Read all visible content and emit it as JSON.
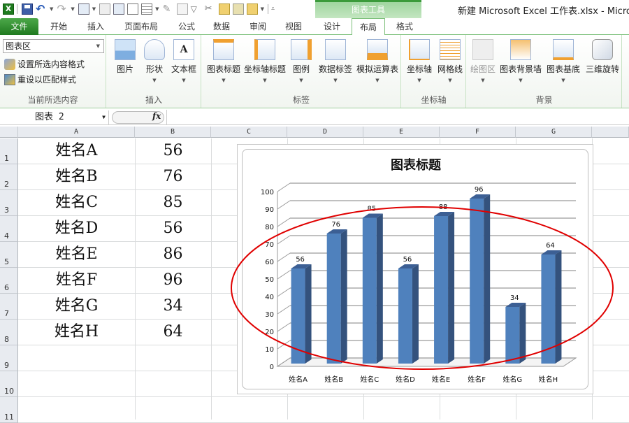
{
  "window": {
    "title": "新建 Microsoft Excel 工作表.xlsx  -  Microsoft Excel",
    "context_group": "图表工具"
  },
  "quick_access": {
    "icons": [
      "excel-logo-icon",
      "save-icon",
      "undo-icon",
      "redo-icon",
      "form-icon",
      "form2-icon",
      "form3-icon",
      "print-preview-icon",
      "table-icon",
      "format-painter-icon",
      "copy-icon",
      "filter-icon",
      "clear-icon",
      "macro-icon",
      "properties-icon",
      "tools-icon",
      "customize-icon"
    ]
  },
  "tabs": [
    {
      "label": "文件",
      "kind": "file"
    },
    {
      "label": "开始"
    },
    {
      "label": "插入"
    },
    {
      "label": "页面布局"
    },
    {
      "label": "公式"
    },
    {
      "label": "数据"
    },
    {
      "label": "审阅"
    },
    {
      "label": "视图"
    },
    {
      "label": "设计"
    },
    {
      "label": "布局",
      "active": true
    },
    {
      "label": "格式"
    }
  ],
  "ribbon": {
    "current_selection": {
      "combo_value": "图表区",
      "format_selection": "设置所选内容格式",
      "reset_style": "重设以匹配样式",
      "label": "当前所选内容"
    },
    "insert": {
      "label": "插入",
      "buttons": [
        "图片",
        "形状",
        "文本框"
      ]
    },
    "labels": {
      "label": "标签",
      "buttons": [
        "图表标题",
        "坐标轴标题",
        "图例",
        "数据标签",
        "模拟运算表"
      ]
    },
    "axes": {
      "label": "坐标轴",
      "buttons": [
        "坐标轴",
        "网格线"
      ]
    },
    "background": {
      "label": "背景",
      "buttons": [
        "绘图区",
        "图表背景墙",
        "图表基底",
        "三维旋转"
      ]
    }
  },
  "formula_bar": {
    "name_box": "图表 2",
    "fx_label": "fx",
    "formula": ""
  },
  "sheet": {
    "columns": [
      "A",
      "B",
      "C",
      "D",
      "E",
      "F",
      "G"
    ],
    "rows": [
      "1",
      "2",
      "3",
      "4",
      "5",
      "6",
      "7",
      "8",
      "9",
      "10",
      "11"
    ],
    "cells": [
      [
        "姓名A",
        "56"
      ],
      [
        "姓名B",
        "76"
      ],
      [
        "姓名C",
        "85"
      ],
      [
        "姓名D",
        "56"
      ],
      [
        "姓名E",
        "86"
      ],
      [
        "姓名F",
        "96"
      ],
      [
        "姓名G",
        "34"
      ],
      [
        "姓名H",
        "64"
      ]
    ]
  },
  "chart_data": {
    "type": "bar",
    "variant": "3d-clustered-column",
    "title": "图表标题",
    "categories": [
      "姓名A",
      "姓名B",
      "姓名C",
      "姓名D",
      "姓名E",
      "姓名F",
      "姓名G",
      "姓名H"
    ],
    "values": [
      56,
      76,
      85,
      56,
      86,
      96,
      34,
      64
    ],
    "data_labels": [
      "56",
      "76",
      "85",
      "56",
      "88",
      "96",
      "34",
      "64"
    ],
    "xlabel": "",
    "ylabel": "",
    "ylim": [
      0,
      100
    ],
    "yticks": [
      0,
      10,
      20,
      30,
      40,
      50,
      60,
      70,
      80,
      90,
      100
    ],
    "grid": true,
    "legend": "none",
    "bar_color": "#4f81bd",
    "bar_side_color": "#34527d",
    "annotation": "red ellipse around bars"
  }
}
